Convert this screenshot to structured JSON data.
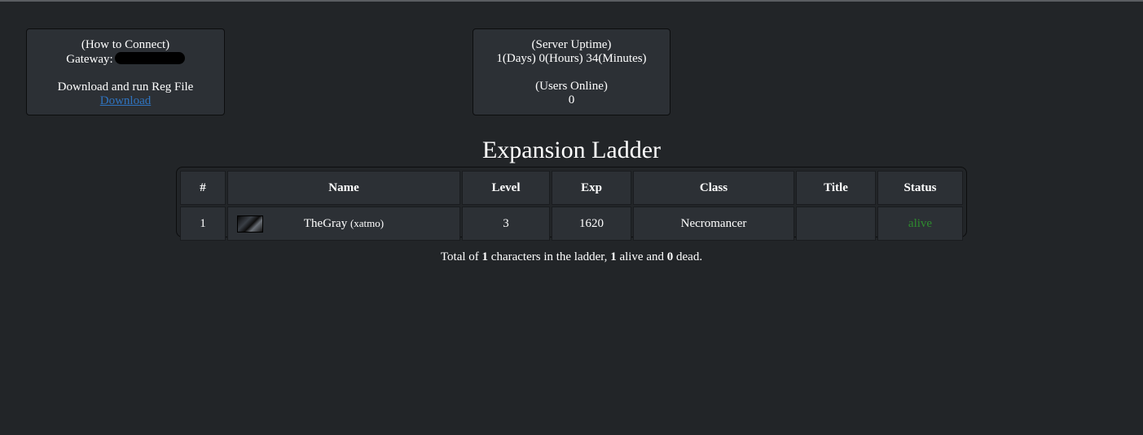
{
  "connect": {
    "heading": "(How to Connect)",
    "gateway_label": "Gateway:",
    "reg_text": "Download and run Reg File",
    "download_label": "Download"
  },
  "server": {
    "uptime_heading": "(Server Uptime)",
    "uptime_value": "1(Days) 0(Hours) 34(Minutes)",
    "users_heading": "(Users Online)",
    "users_value": "0"
  },
  "ladder": {
    "title": "Expansion Ladder",
    "columns": [
      "#",
      "Name",
      "Level",
      "Exp",
      "Class",
      "Title",
      "Status"
    ],
    "rows": [
      {
        "rank": "1",
        "name": "TheGray",
        "account": "(xatmo)",
        "level": "3",
        "exp": "1620",
        "class": "Necromancer",
        "title": "",
        "status": "alive"
      }
    ]
  },
  "summary": {
    "prefix": "Total of ",
    "total": "1",
    "mid1": " characters in the ladder, ",
    "alive": "1",
    "mid2": " alive and ",
    "dead": "0",
    "suffix": " dead."
  },
  "colors": {
    "background": "#222528",
    "panel": "#2c3035",
    "link": "#2f74c0",
    "alive": "#2e8b2e"
  }
}
